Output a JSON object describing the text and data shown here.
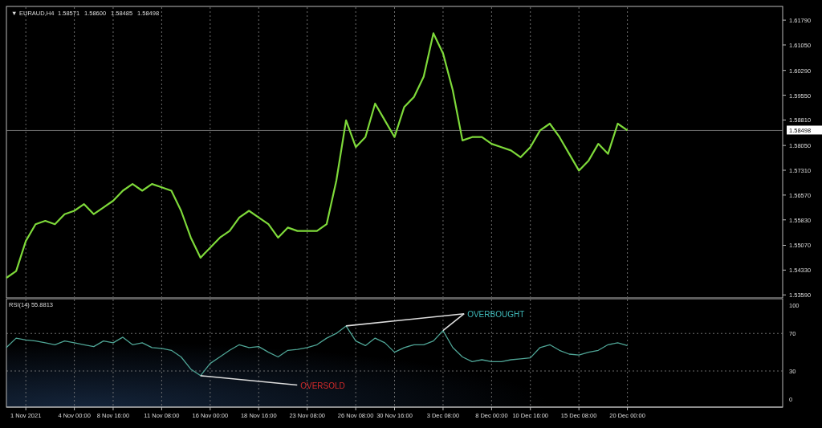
{
  "header": {
    "toggle": "▼",
    "symbol": "EURAUD,H4",
    "values": [
      "1.58571",
      "1.58600",
      "1.58485",
      "1.58498"
    ]
  },
  "price_chart": {
    "chart_data": {
      "type": "line",
      "grid": true,
      "ylim": [
        1.535,
        1.622
      ],
      "yticks": [
        {
          "value": 1.6179,
          "label": "1.61790"
        },
        {
          "value": 1.6105,
          "label": "1.61050"
        },
        {
          "value": 1.6029,
          "label": "1.60290"
        },
        {
          "value": 1.5955,
          "label": "1.59550"
        },
        {
          "value": 1.5881,
          "label": "1.58810"
        },
        {
          "value": 1.5805,
          "label": "1.58050"
        },
        {
          "value": 1.5731,
          "label": "1.57310"
        },
        {
          "value": 1.5657,
          "label": "1.56570"
        },
        {
          "value": 1.5583,
          "label": "1.55830"
        },
        {
          "value": 1.5507,
          "label": "1.55070"
        },
        {
          "value": 1.5433,
          "label": "1.54330"
        },
        {
          "value": 1.5359,
          "label": "1.53590"
        }
      ],
      "ref_lines": [
        {
          "axis": "y",
          "value": 1.58498,
          "label": "1.58498"
        }
      ],
      "series": [
        {
          "color": "#7ed93a",
          "values": [
            1.541,
            1.543,
            1.552,
            1.557,
            1.558,
            1.557,
            1.56,
            1.561,
            1.563,
            1.56,
            1.562,
            1.564,
            1.567,
            1.569,
            1.567,
            1.569,
            1.568,
            1.567,
            1.561,
            1.553,
            1.547,
            1.55,
            1.553,
            1.555,
            1.559,
            1.561,
            1.559,
            1.557,
            1.553,
            1.556,
            1.555,
            1.555,
            1.555,
            1.557,
            1.57,
            1.588,
            1.58,
            1.583,
            1.593,
            1.588,
            1.583,
            1.592,
            1.595,
            1.601,
            1.614,
            1.608,
            1.597,
            1.582,
            1.583,
            1.583,
            1.581,
            1.58,
            1.579,
            1.577,
            1.58,
            1.585,
            1.587,
            1.583,
            1.578,
            1.573,
            1.576,
            1.581,
            1.578,
            1.587,
            1.585
          ]
        }
      ]
    }
  },
  "rsi_panel": {
    "value": "55.8813",
    "chart_data": {
      "type": "line",
      "grid": true,
      "ylim": [
        -8.5,
        107
      ],
      "yticks": [
        0,
        30,
        70,
        100
      ],
      "categories": [
        null,
        null,
        "1 Nov 2021",
        null,
        null,
        null,
        null,
        "4 Nov 00:00",
        null,
        null,
        null,
        "8 Nov 16:00",
        null,
        null,
        null,
        null,
        "11 Nov 08:00",
        null,
        null,
        null,
        null,
        "16 Nov 00:00",
        null,
        null,
        null,
        null,
        "18 Nov 16:00",
        null,
        null,
        null,
        null,
        "23 Nov 08:00",
        null,
        null,
        null,
        null,
        "26 Nov 08:00",
        null,
        null,
        null,
        "30 Nov 16:00",
        null,
        null,
        null,
        null,
        "3 Dec 08:00",
        null,
        null,
        null,
        null,
        "8 Dec 00:00",
        null,
        null,
        null,
        "10 Dec 16:00",
        null,
        null,
        null,
        null,
        "15 Dec 08:00",
        null,
        null,
        null,
        null,
        "20 Dec 00:00"
      ],
      "series": [
        {
          "name": "RSI(14)",
          "color": "#4fa596",
          "values": [
            55,
            65,
            63,
            62,
            60,
            58,
            62,
            60,
            58,
            56,
            62,
            60,
            66,
            58,
            60,
            55,
            54,
            52,
            45,
            32,
            25,
            38,
            45,
            52,
            58,
            55,
            56,
            50,
            45,
            52,
            53,
            55,
            58,
            65,
            70,
            78,
            62,
            57,
            65,
            60,
            50,
            55,
            58,
            58,
            62,
            73,
            55,
            45,
            40,
            42,
            40,
            40,
            42,
            43,
            44,
            55,
            58,
            52,
            48,
            47,
            50,
            52,
            58,
            60,
            57
          ]
        }
      ]
    },
    "notes": [
      {
        "kind": "above",
        "text": "OVERBOUGHT",
        "color": "#3fb8b8"
      },
      {
        "kind": "below",
        "text": "OVERSOLD",
        "color": "#d42a2a"
      }
    ]
  }
}
